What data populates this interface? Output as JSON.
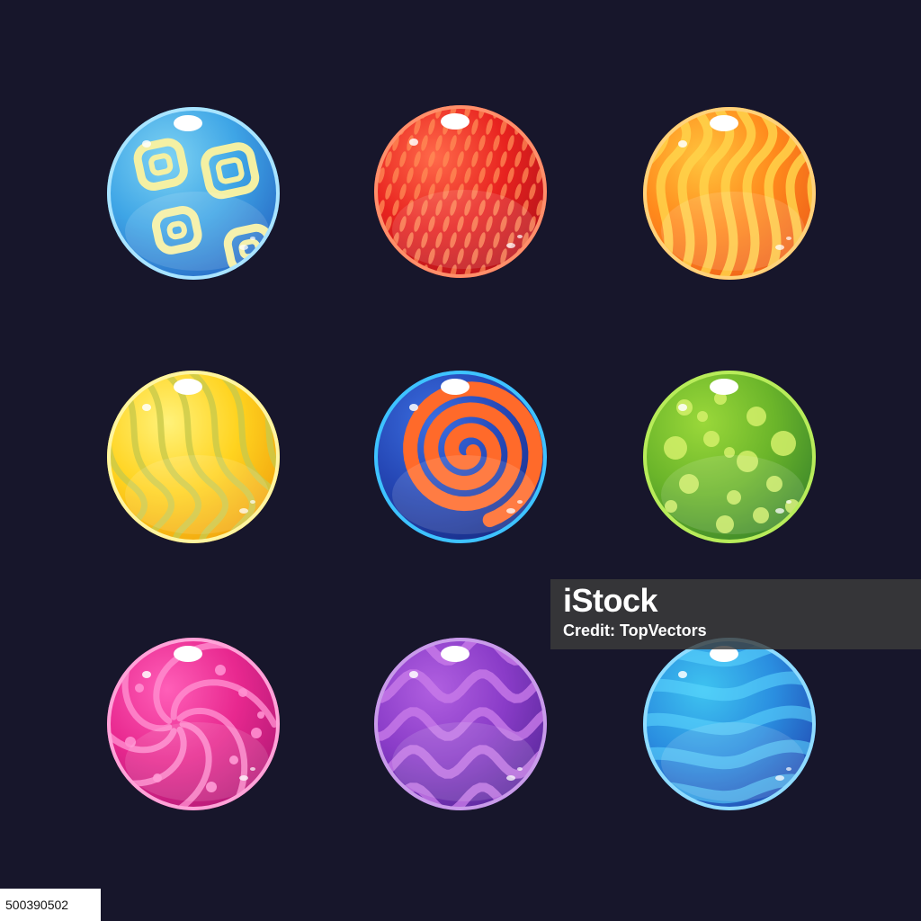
{
  "background_color": "#17162b",
  "orbs": [
    {
      "name": "blue-swirl-orb",
      "pattern": "square-swirls",
      "colors": {
        "light": "#7fd3f3",
        "mid": "#3ea5e6",
        "dark": "#2a6fc8",
        "pattern": "#f4f0a3",
        "rim": "#a9e4ff"
      }
    },
    {
      "name": "red-striped-orb",
      "pattern": "dashes",
      "colors": {
        "light": "#ff6a4a",
        "mid": "#e8231f",
        "dark": "#b9131a",
        "pattern": "#ff8c55",
        "rim": "#ff8f6a"
      }
    },
    {
      "name": "orange-flame-orb",
      "pattern": "flames",
      "colors": {
        "light": "#ffc43d",
        "mid": "#ff8a1c",
        "dark": "#f0641a",
        "pattern": "#ffd24a",
        "rim": "#ffd27a"
      }
    },
    {
      "name": "yellow-wave-orb",
      "pattern": "waves",
      "colors": {
        "light": "#fff27a",
        "mid": "#ffd31f",
        "dark": "#f2a70f",
        "pattern": "#c9c94a",
        "rim": "#fff5a0"
      }
    },
    {
      "name": "blue-spiral-orb",
      "pattern": "spiral",
      "colors": {
        "light": "#3b6ee0",
        "mid": "#2547b5",
        "dark": "#1a2f8a",
        "pattern": "#ff6a2a",
        "rim": "#3ec3ff"
      }
    },
    {
      "name": "green-dotted-orb",
      "pattern": "dots",
      "colors": {
        "light": "#9ad83a",
        "mid": "#6bb52a",
        "dark": "#3f8a2a",
        "pattern": "#d4f06a",
        "rim": "#b8ec5a"
      }
    },
    {
      "name": "pink-vortex-orb",
      "pattern": "vortex",
      "colors": {
        "light": "#ff5fb8",
        "mid": "#e8288f",
        "dark": "#b81a78",
        "pattern": "#ff8fd0",
        "rim": "#ffa3d8"
      }
    },
    {
      "name": "purple-zigzag-orb",
      "pattern": "zigzag",
      "colors": {
        "light": "#b05fe0",
        "mid": "#8a3cc8",
        "dark": "#5e2aa0",
        "pattern": "#c87ae8",
        "rim": "#c99bea"
      }
    },
    {
      "name": "blue-ocean-orb",
      "pattern": "ocean",
      "colors": {
        "light": "#3ec3f0",
        "mid": "#2a8ee0",
        "dark": "#2352b8",
        "pattern": "#5fd8ff",
        "rim": "#8fdcff"
      }
    }
  ],
  "watermark": {
    "brand": "iStock",
    "credit": "Credit: TopVectors"
  },
  "image_id": "500390502"
}
